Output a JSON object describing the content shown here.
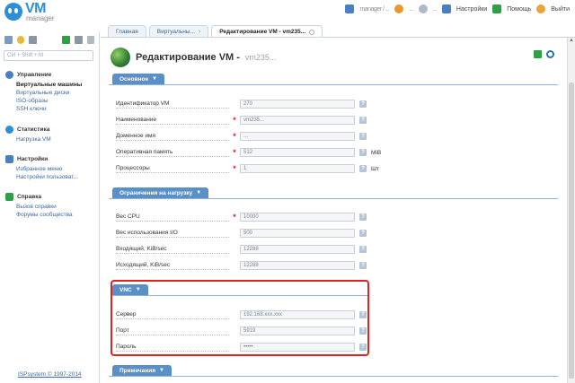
{
  "app": {
    "logo_main": "VM",
    "logo_sub": "manager"
  },
  "topbar": {
    "user_blur_1": "manager / ...",
    "user_blur_2": "...",
    "lang": "...",
    "settings": "Настройки",
    "help": "Помощь",
    "logout": "Выйти"
  },
  "tabs": [
    {
      "label": "Главная"
    },
    {
      "label": "Виртуальны..."
    },
    {
      "label": "Редактирование VM - vm235..."
    }
  ],
  "sidebar": {
    "search_placeholder": "Ctrl + Shift + M",
    "groups": [
      {
        "title": "Управление",
        "color": "#4a7fc1",
        "items": [
          "Виртуальные машины",
          "Виртуальные диски",
          "ISO-образы",
          "SSH ключи"
        ]
      },
      {
        "title": "Статистика",
        "color": "#2d8fd6",
        "items": [
          "Нагрузка VM"
        ]
      },
      {
        "title": "Настройки",
        "color": "#4a7fc1",
        "items": [
          "Избранное меню",
          "Настройки пользоват..."
        ]
      },
      {
        "title": "Справка",
        "color": "#2f9e44",
        "items": [
          "Вызов справки",
          "Форумы сообщества"
        ]
      }
    ],
    "copyright": "ISPsystem © 1997-2014"
  },
  "page": {
    "title": "Редактирование VM -",
    "title_blur": "vm235..."
  },
  "sections": {
    "basic": "Основное",
    "limits": "Ограничения на нагрузку",
    "vnc": "VNC",
    "notes": "Примечания"
  },
  "basic_rows": [
    {
      "label": "Идентификатор VM",
      "value": "270",
      "required": false,
      "unit": ""
    },
    {
      "label": "Наименование",
      "value": "vm235...",
      "required": true,
      "unit": ""
    },
    {
      "label": "Доменное имя",
      "value": "...",
      "required": true,
      "unit": ""
    },
    {
      "label": "Оперативная память",
      "value": "512",
      "required": true,
      "unit": "MiB"
    },
    {
      "label": "Процессоры",
      "value": "1",
      "required": true,
      "unit": "Шт"
    }
  ],
  "limit_rows": [
    {
      "label": "Вес CPU",
      "value": "10000",
      "required": true
    },
    {
      "label": "Вес использования I/O",
      "value": "500",
      "required": false
    },
    {
      "label": "Входящий, KiB/sec",
      "value": "12288",
      "required": false
    },
    {
      "label": "Исходящий, KiB/sec",
      "value": "12288",
      "required": false
    }
  ],
  "vnc_rows": [
    {
      "label": "Сервер",
      "value": "192.168.xxx.xxx"
    },
    {
      "label": "Порт",
      "value": "5919"
    },
    {
      "label": "Пароль",
      "value": "•••••"
    }
  ],
  "help_glyph": "?",
  "colors": {
    "accent": "#5a8fc8",
    "highlight": "#e0231e",
    "required": "#e02020"
  }
}
